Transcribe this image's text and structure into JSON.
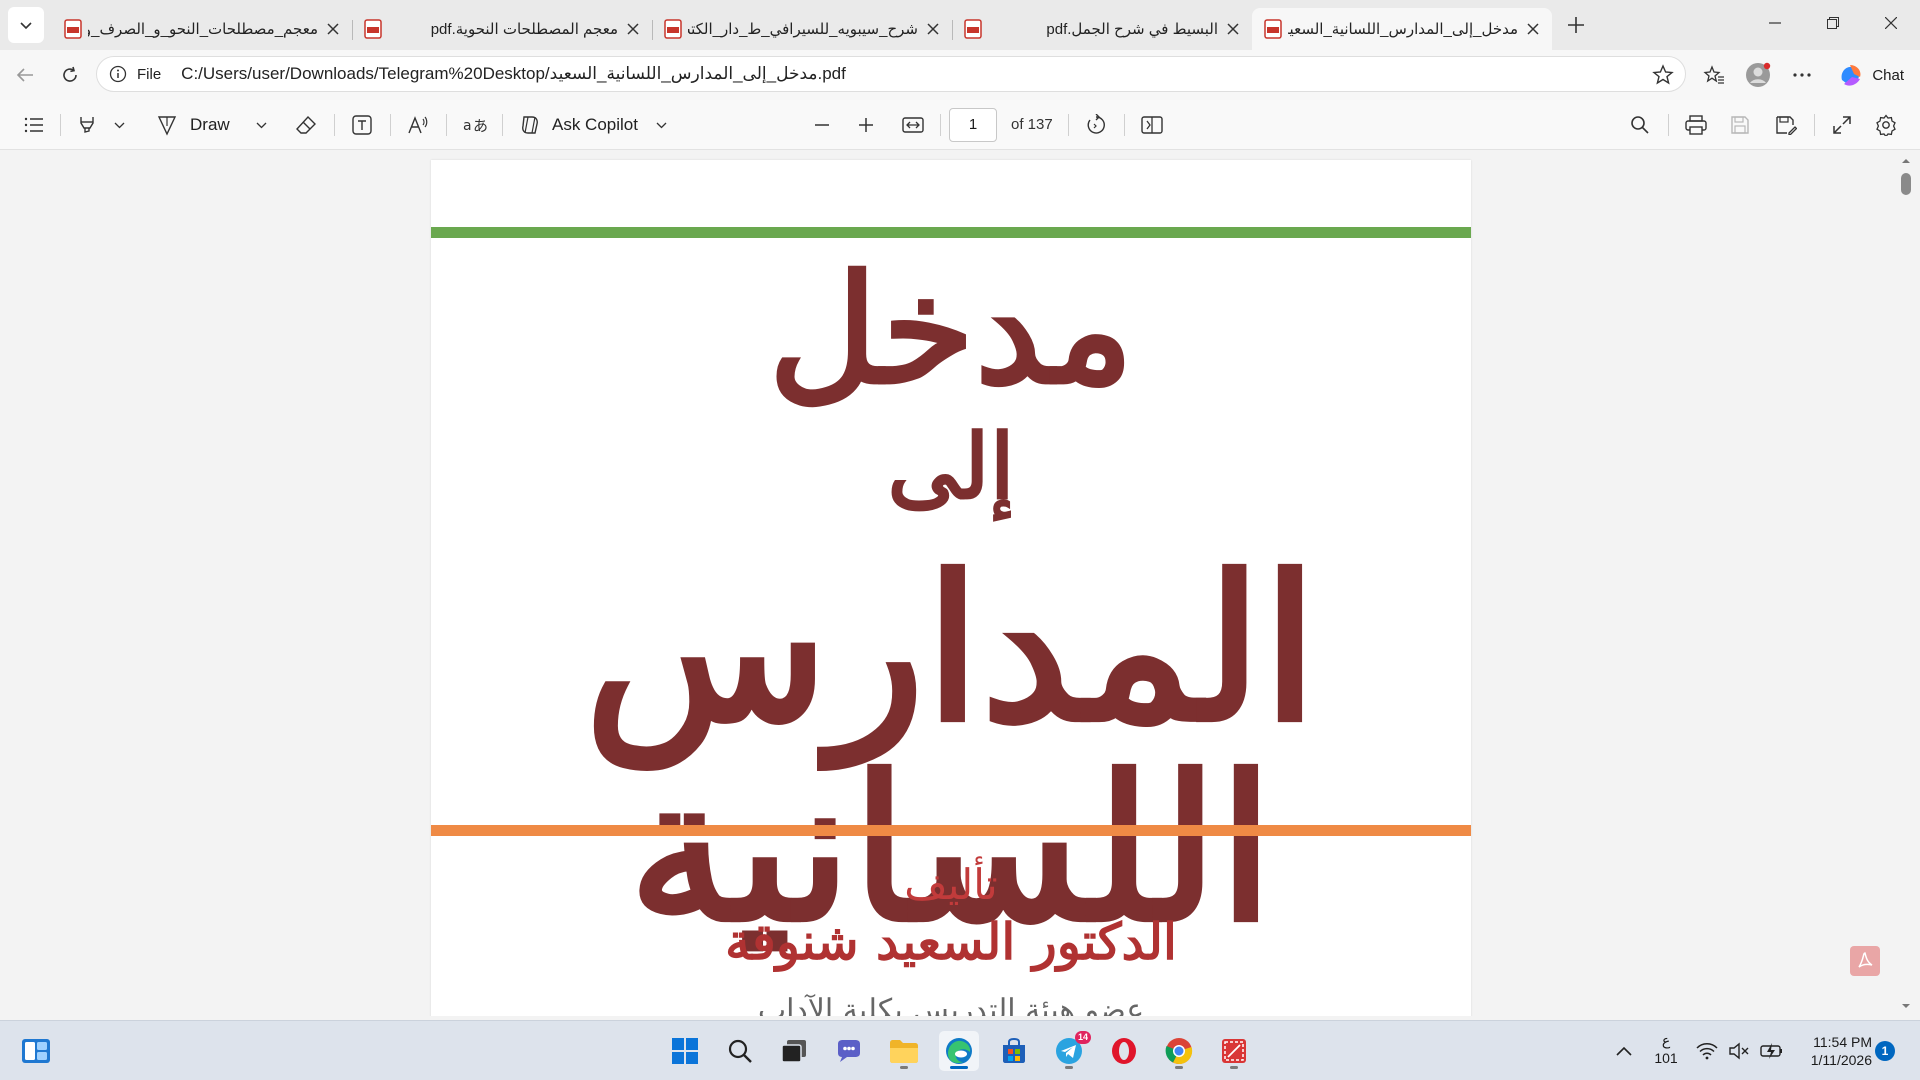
{
  "browser": {
    "tabs": [
      {
        "title": "معجم_مصطلحات_النحو_و_الصرف_و",
        "active": false
      },
      {
        "title": "معجم المصطلحات النحوية.pdf",
        "active": false
      },
      {
        "title": "شرح_سيبويه_للسيرافي_ط_دار_الكتب",
        "active": false
      },
      {
        "title": "البسيط في شرح الجمل.pdf",
        "active": false
      },
      {
        "title": "مدخل_إلى_المدارس_اللسانية_السعيد",
        "active": true
      }
    ],
    "address": {
      "scheme_label": "File",
      "url": "C:/Users/user/Downloads/Telegram%20Desktop/مدخل_إلى_المدارس_اللسانية_السعيد.pdf"
    },
    "chat_label": "Chat"
  },
  "pdf_toolbar": {
    "draw_label": "Draw",
    "copilot_label": "Ask Copilot",
    "page_current": "1",
    "page_total_label": "of 137"
  },
  "document": {
    "title_line1": "مدخل",
    "title_line2": "إلى",
    "title_line3": "المدارس اللسانية",
    "author_label": "تأليف",
    "author_name": "الدكتور السعيد شنوقة",
    "cutoff_line": "عضو هيئة التدريس بكلية الآداب"
  },
  "taskbar": {
    "keyboard_lang": "ع",
    "keyboard_sub": "101",
    "time": "11:54 PM",
    "date": "1/11/2026",
    "notifications": "1",
    "telegram_badge": "14"
  },
  "colors": {
    "green_stripe": "#6aa84f",
    "orange_stripe": "#ef8a45",
    "title_red": "#7c2f2f",
    "author_red": "#b03232",
    "edge_blue": "#0067c0"
  }
}
